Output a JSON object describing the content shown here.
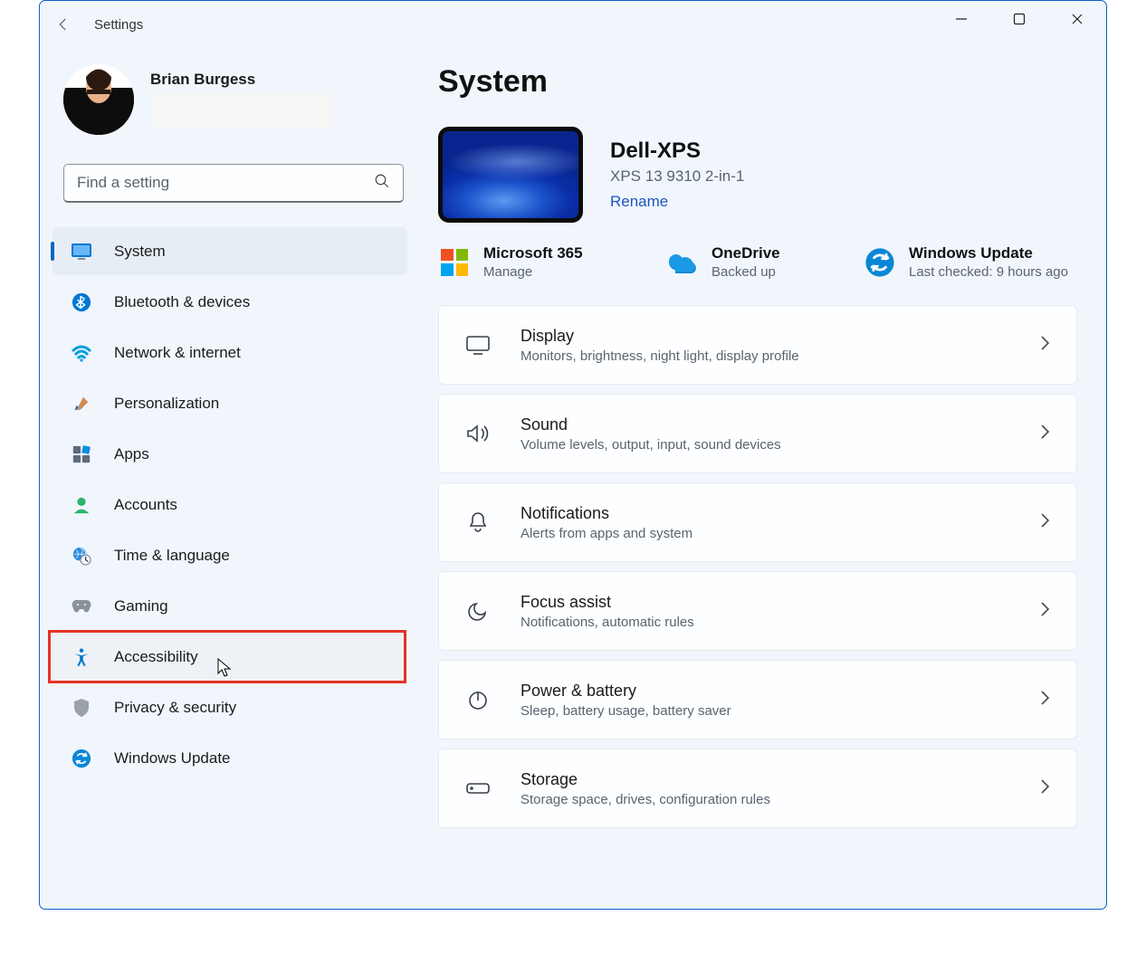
{
  "window": {
    "title": "Settings"
  },
  "profile": {
    "name": "Brian Burgess"
  },
  "search": {
    "placeholder": "Find a setting"
  },
  "sidebar": {
    "items": [
      {
        "id": "system",
        "label": "System"
      },
      {
        "id": "bluetooth",
        "label": "Bluetooth & devices"
      },
      {
        "id": "network",
        "label": "Network & internet"
      },
      {
        "id": "personalization",
        "label": "Personalization"
      },
      {
        "id": "apps",
        "label": "Apps"
      },
      {
        "id": "accounts",
        "label": "Accounts"
      },
      {
        "id": "time",
        "label": "Time & language"
      },
      {
        "id": "gaming",
        "label": "Gaming"
      },
      {
        "id": "accessibility",
        "label": "Accessibility"
      },
      {
        "id": "privacy",
        "label": "Privacy & security"
      },
      {
        "id": "update",
        "label": "Windows Update"
      }
    ],
    "selected_id": "system",
    "highlighted_id": "accessibility"
  },
  "page": {
    "title": "System",
    "device": {
      "name": "Dell-XPS",
      "model": "XPS 13 9310 2-in-1",
      "rename_label": "Rename"
    },
    "status_cards": [
      {
        "id": "m365",
        "title": "Microsoft 365",
        "sub": "Manage"
      },
      {
        "id": "onedrive",
        "title": "OneDrive",
        "sub": "Backed up"
      },
      {
        "id": "update",
        "title": "Windows Update",
        "sub": "Last checked: 9 hours ago"
      }
    ],
    "settings": [
      {
        "id": "display",
        "title": "Display",
        "sub": "Monitors, brightness, night light, display profile"
      },
      {
        "id": "sound",
        "title": "Sound",
        "sub": "Volume levels, output, input, sound devices"
      },
      {
        "id": "notifications",
        "title": "Notifications",
        "sub": "Alerts from apps and system"
      },
      {
        "id": "focus",
        "title": "Focus assist",
        "sub": "Notifications, automatic rules"
      },
      {
        "id": "power",
        "title": "Power & battery",
        "sub": "Sleep, battery usage, battery saver"
      },
      {
        "id": "storage",
        "title": "Storage",
        "sub": "Storage space, drives, configuration rules"
      }
    ]
  }
}
